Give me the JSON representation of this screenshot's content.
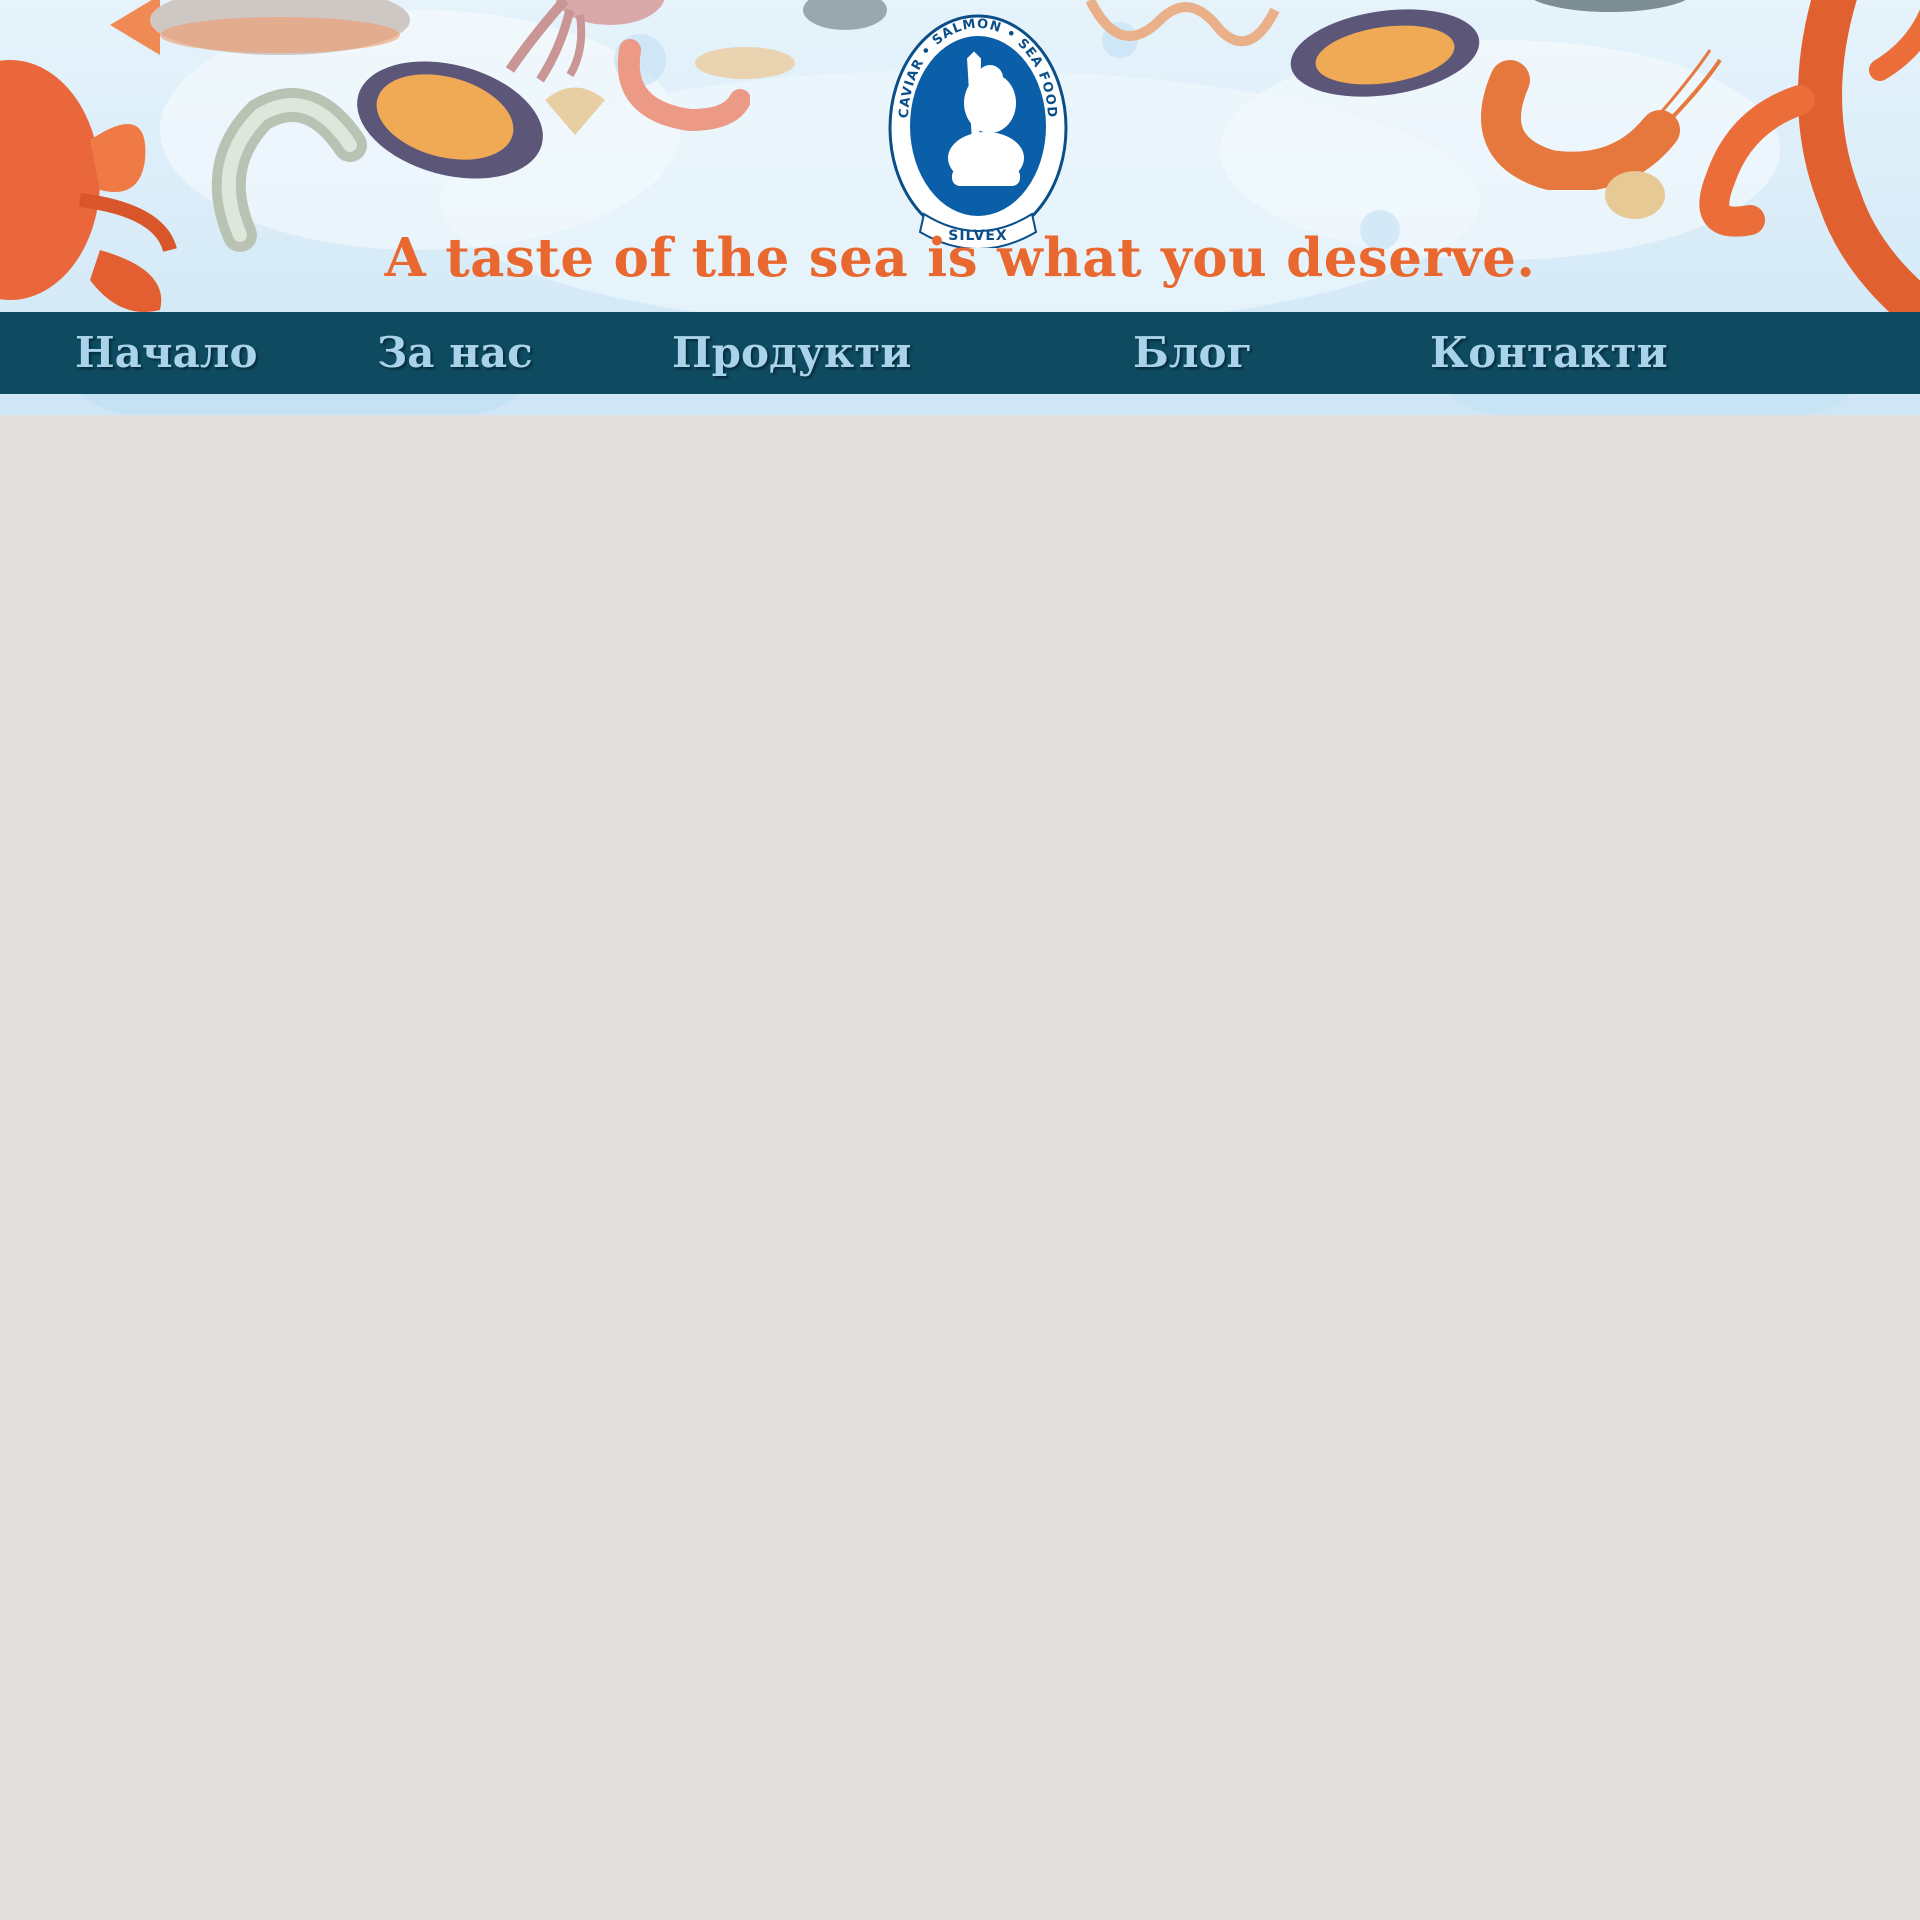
{
  "header": {
    "logo": {
      "top_text": "CAVIAR • SALMON • SEA FOOD",
      "bottom_text": "SILVEX"
    },
    "tagline": "A taste of the sea is what you deserve."
  },
  "nav": {
    "items": [
      {
        "label": "Начало"
      },
      {
        "label": "За нас"
      },
      {
        "label": "Продукти"
      },
      {
        "label": "Блог"
      },
      {
        "label": "Контакти"
      }
    ]
  },
  "colors": {
    "nav_background": "#0e4a60",
    "nav_text": "#a9d3ea",
    "tagline": "#e8682f",
    "logo_blue": "#0b5ea8",
    "page_background": "#e2dfde"
  }
}
